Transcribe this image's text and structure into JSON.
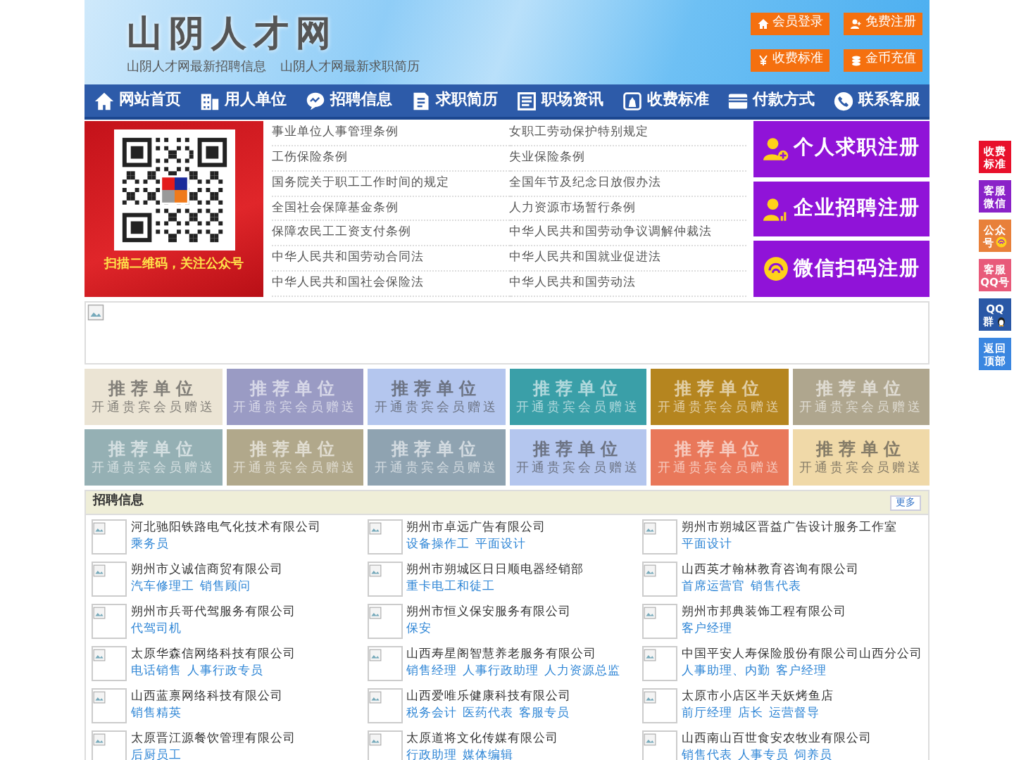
{
  "header": {
    "site_title": "山阴人才网",
    "taglines": [
      "山阴人才网最新招聘信息",
      "山阴人才网最新求职简历"
    ],
    "buttons": [
      {
        "label": "会员登录",
        "kind": "home"
      },
      {
        "label": "免费注册",
        "kind": "user"
      },
      {
        "label": "收费标准",
        "kind": "yen"
      },
      {
        "label": "金币充值",
        "kind": "coins"
      }
    ]
  },
  "nav": [
    {
      "label": "网站首页",
      "kind": "home"
    },
    {
      "label": "用人单位",
      "kind": "building"
    },
    {
      "label": "招聘信息",
      "kind": "chat"
    },
    {
      "label": "求职简历",
      "kind": "doc"
    },
    {
      "label": "职场资讯",
      "kind": "list"
    },
    {
      "label": "收费标准",
      "kind": "bag"
    },
    {
      "label": "付款方式",
      "kind": "card"
    },
    {
      "label": "联系客服",
      "kind": "phone"
    }
  ],
  "qr": {
    "caption": "扫描二维码，关注公众号"
  },
  "law_links": [
    "事业单位人事管理条例",
    "女职工劳动保护特别规定",
    "工伤保险条例",
    "失业保险条例",
    "国务院关于职工工作时间的规定",
    "全国年节及纪念日放假办法",
    "全国社会保障基金条例",
    "人力资源市场暂行条例",
    "保障农民工工资支付条例",
    "中华人民共和国劳动争议调解仲裁法",
    "中华人民共和国劳动合同法",
    "中华人民共和国就业促进法",
    "中华人民共和国社会保险法",
    "中华人民共和国劳动法"
  ],
  "register_buttons": [
    {
      "label": "个人求职注册",
      "kind": "person"
    },
    {
      "label": "企业招聘注册",
      "kind": "company"
    },
    {
      "label": "微信扫码注册",
      "kind": "wechat"
    }
  ],
  "tiles": [
    {
      "title": "推荐单位",
      "subtitle": "开通贵宾会员赠送",
      "color": "#ebe4d4"
    },
    {
      "title": "推荐单位",
      "subtitle": "开通贵宾会员赠送",
      "color": "#9a9bc4"
    },
    {
      "title": "推荐单位",
      "subtitle": "开通贵宾会员赠送",
      "color": "#b4c6ee"
    },
    {
      "title": "推荐单位",
      "subtitle": "开通贵宾会员赠送",
      "color": "#3a9fa8"
    },
    {
      "title": "推荐单位",
      "subtitle": "开通贵宾会员赠送",
      "color": "#b5851f"
    },
    {
      "title": "推荐单位",
      "subtitle": "开通贵宾会员赠送",
      "color": "#afa68e"
    },
    {
      "title": "推荐单位",
      "subtitle": "开通贵宾会员赠送",
      "color": "#95b0b4"
    },
    {
      "title": "推荐单位",
      "subtitle": "开通贵宾会员赠送",
      "color": "#b1a88b"
    },
    {
      "title": "推荐单位",
      "subtitle": "开通贵宾会员赠送",
      "color": "#8fa3b1"
    },
    {
      "title": "推荐单位",
      "subtitle": "开通贵宾会员赠送",
      "color": "#b4c6ee"
    },
    {
      "title": "推荐单位",
      "subtitle": "开通贵宾会员赠送",
      "color": "#e9785a"
    },
    {
      "title": "推荐单位",
      "subtitle": "开通贵宾会员赠送",
      "color": "#f0d9a8"
    }
  ],
  "jobs": {
    "title": "招聘信息",
    "more": "更多",
    "companies": [
      {
        "name": "河北驰阳铁路电气化技术有限公司",
        "jobs": [
          "乘务员"
        ]
      },
      {
        "name": "朔州市卓远广告有限公司",
        "jobs": [
          "设备操作工",
          "平面设计"
        ]
      },
      {
        "name": "朔州市朔城区晋益广告设计服务工作室",
        "jobs": [
          "平面设计"
        ]
      },
      {
        "name": "朔州市义诚信商贸有限公司",
        "jobs": [
          "汽车修理工",
          "销售顾问"
        ]
      },
      {
        "name": "朔州市朔城区日日顺电器经销部",
        "jobs": [
          "重卡电工和徒工"
        ]
      },
      {
        "name": "山西英才翰林教育咨询有限公司",
        "jobs": [
          "首席运营官",
          "销售代表"
        ]
      },
      {
        "name": "朔州市兵哥代驾服务有限公司",
        "jobs": [
          "代驾司机"
        ]
      },
      {
        "name": "朔州市恒义保安服务有限公司",
        "jobs": [
          "保安"
        ]
      },
      {
        "name": "朔州市邦典装饰工程有限公司",
        "jobs": [
          "客户经理"
        ]
      },
      {
        "name": "太原华森信网络科技有限公司",
        "jobs": [
          "电话销售",
          "人事行政专员"
        ]
      },
      {
        "name": "山西寿星阁智慧养老服务有限公司",
        "jobs": [
          "销售经理",
          "人事行政助理",
          "人力资源总监"
        ]
      },
      {
        "name": "中国平安人寿保险股份有限公司山西分公司",
        "jobs": [
          "人事助理、内勤",
          "客户经理"
        ]
      },
      {
        "name": "山西蓝禀网络科技有限公司",
        "jobs": [
          "销售精英"
        ]
      },
      {
        "name": "山西爱唯乐健康科技有限公司",
        "jobs": [
          "税务会计",
          "医药代表",
          "客服专员"
        ]
      },
      {
        "name": "太原市小店区半天妖烤鱼店",
        "jobs": [
          "前厅经理",
          "店长",
          "运营督导"
        ]
      },
      {
        "name": "太原晋江源餐饮管理有限公司",
        "jobs": [
          "后厨员工"
        ]
      },
      {
        "name": "太原道将文化传媒有限公司",
        "jobs": [
          "行政助理",
          "媒体编辑"
        ]
      },
      {
        "name": "山西南山百世食安农牧业有限公司",
        "jobs": [
          "销售代表",
          "人事专员",
          "饲养员"
        ]
      }
    ]
  },
  "side_float": [
    {
      "lines": [
        "收费",
        "标准"
      ],
      "color": "#e8102b"
    },
    {
      "lines": [
        "客服",
        "微信"
      ],
      "color": "#8a22c8"
    },
    {
      "lines": [
        "公众",
        "号"
      ],
      "color": "#e8803a",
      "kind": "wechat"
    },
    {
      "lines": [
        "客服",
        "QQ号"
      ],
      "color": "#e85a7a"
    },
    {
      "lines": [
        "QQ",
        "群"
      ],
      "color": "#2a58a6",
      "kind": "qq"
    },
    {
      "lines": [
        "返回",
        "顶部"
      ],
      "color": "#3a86e0"
    }
  ]
}
